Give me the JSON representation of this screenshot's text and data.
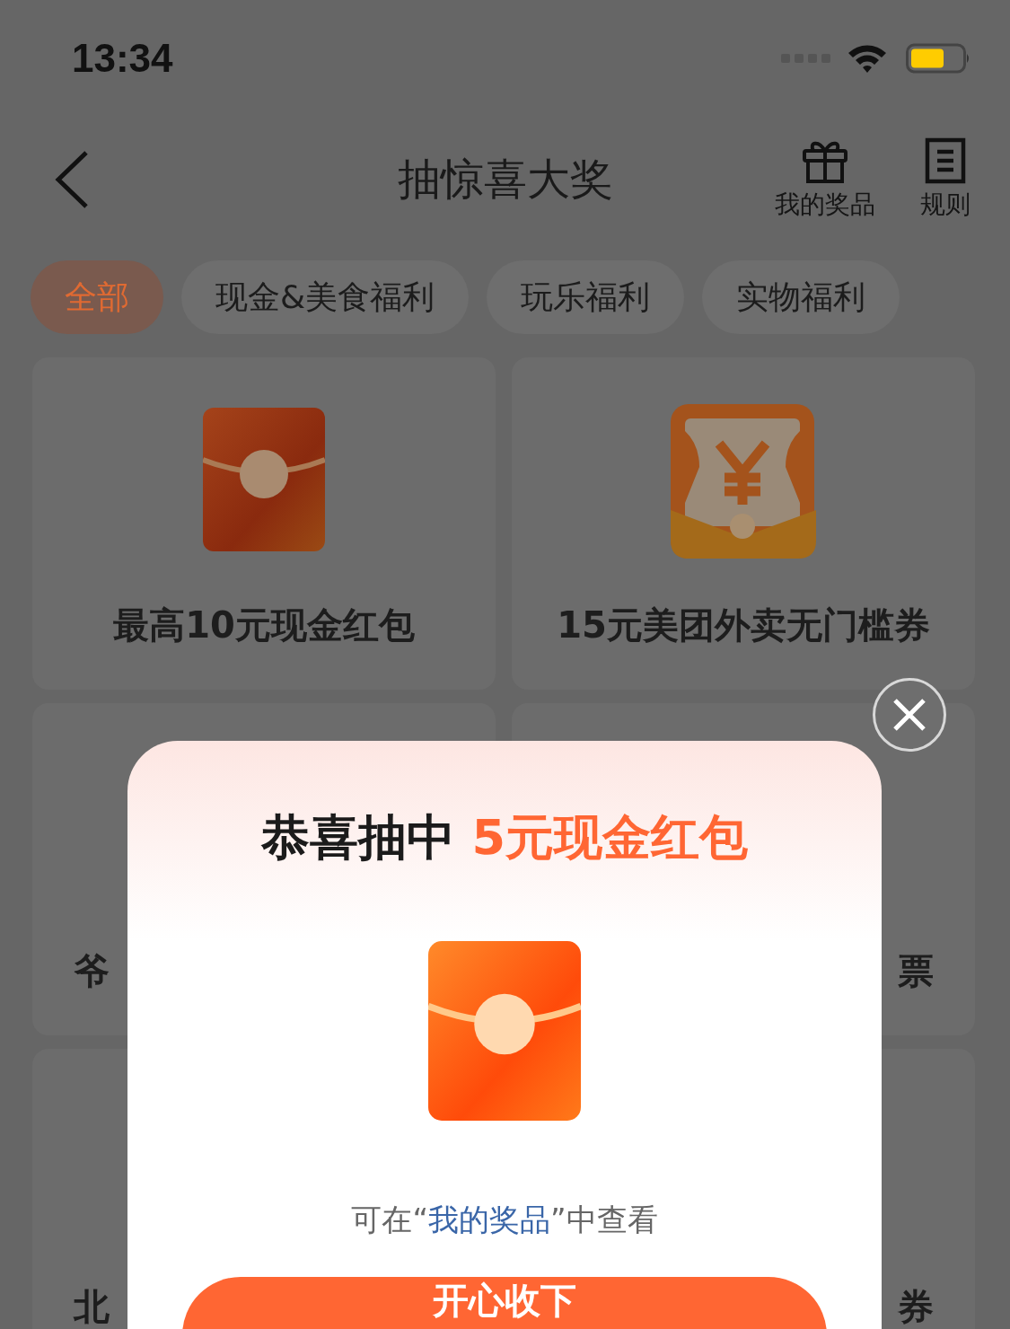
{
  "status_bar": {
    "time": "13:34"
  },
  "nav": {
    "title": "抽惊喜大奖",
    "actions": [
      {
        "label": "我的奖品",
        "kind": "gift"
      },
      {
        "label": "规则",
        "kind": "rules"
      }
    ]
  },
  "tabs": [
    {
      "label": "全部",
      "selected": true
    },
    {
      "label": "现金&美食福利",
      "selected": false
    },
    {
      "label": "玩乐福利",
      "selected": false
    },
    {
      "label": "实物福利",
      "selected": false
    }
  ],
  "prizes": [
    {
      "title": "最高10元现金红包",
      "kind": "envelope"
    },
    {
      "title": "15元美团外卖无门槛券",
      "kind": "coupon"
    },
    {
      "title": "爷",
      "kind": "covered"
    },
    {
      "title": "票",
      "kind": "covered"
    },
    {
      "title": "北",
      "kind": "covered"
    },
    {
      "title": "券",
      "kind": "covered"
    }
  ],
  "dialog": {
    "title": "恭喜抽中",
    "prize": "5元现金红包",
    "hint_before": "可在“",
    "hint_link": "我的奖品",
    "hint_after": "”中查看",
    "button": "开心收下"
  }
}
